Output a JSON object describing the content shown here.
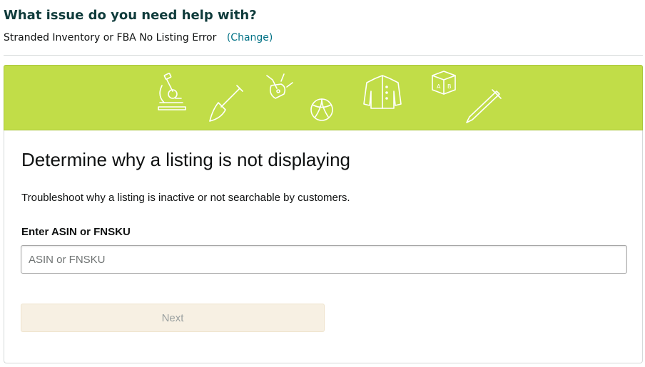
{
  "header": {
    "title": "What issue do you need help with?",
    "issue": "Stranded Inventory or FBA No Listing Error",
    "change_link": "(Change)"
  },
  "banner": {
    "background": "#c1dd48",
    "icons": [
      "microscope-icon",
      "shovel-icon",
      "swiss-knife-icon",
      "beach-ball-icon",
      "jacket-icon",
      "toy-block-icon",
      "pen-icon"
    ]
  },
  "card": {
    "title": "Determine why a listing is not displaying",
    "description": "Troubleshoot why a listing is inactive or not searchable by customers.",
    "field_label": "Enter ASIN or FNSKU",
    "input": {
      "value": "",
      "placeholder": "ASIN or FNSKU"
    },
    "next_label": "Next"
  },
  "colors": {
    "title": "#0f3b3b",
    "link": "#007185",
    "button_disabled_bg": "#f7f0e3",
    "button_disabled_text": "#9aa0a0"
  }
}
